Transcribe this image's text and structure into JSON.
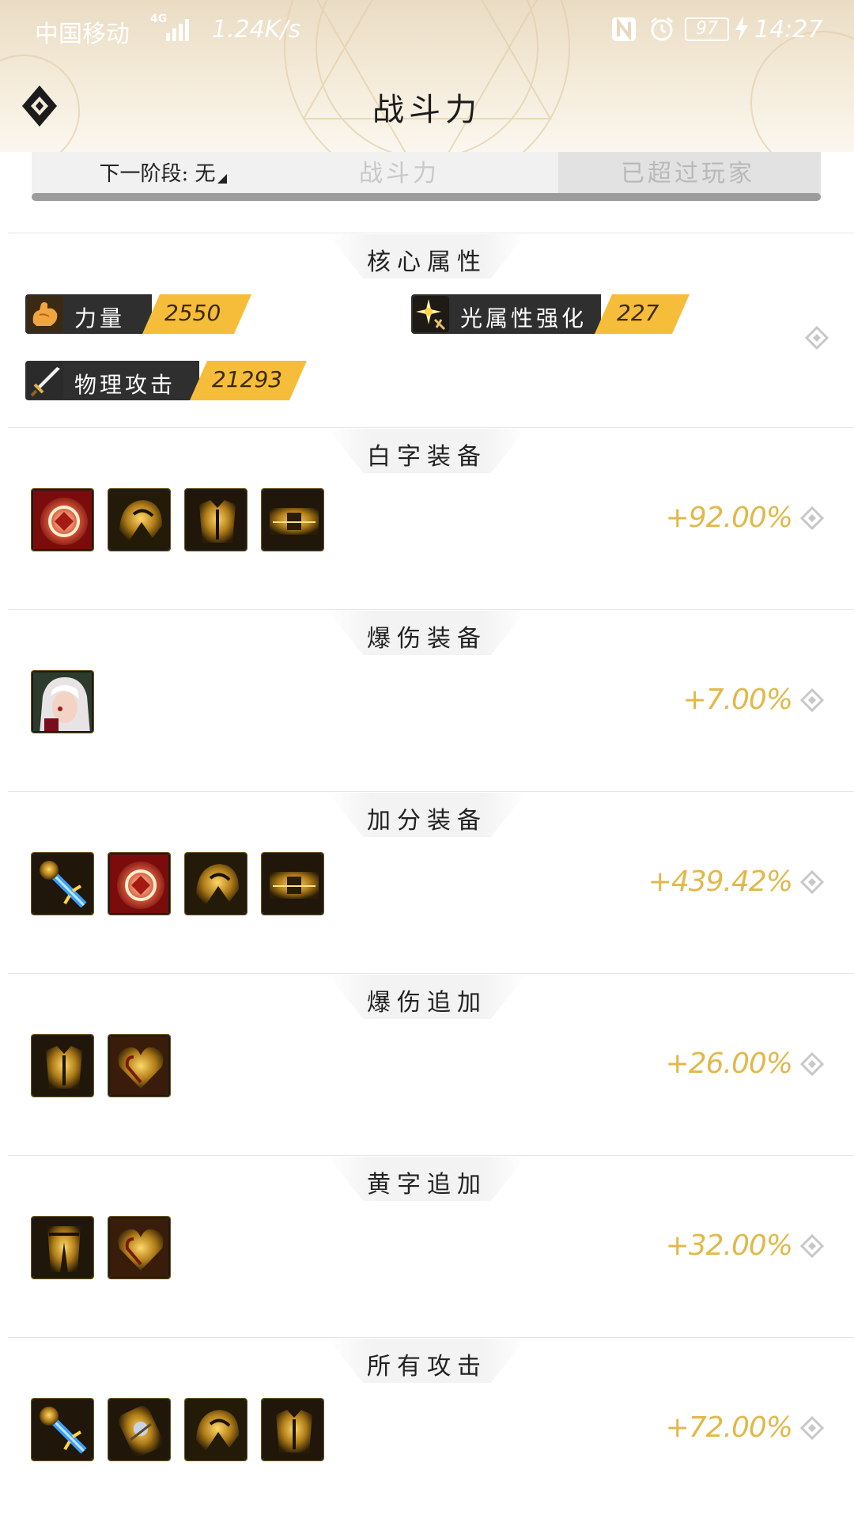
{
  "status_bar": {
    "carrier": "中国移动",
    "network": "4G",
    "speed": "1.24K/s",
    "battery": "97",
    "time": "14:27"
  },
  "header": {
    "title": "战斗力"
  },
  "tabs": {
    "next_stage": "下一阶段: 无",
    "power": "战斗力",
    "exceeded": "已超过玩家"
  },
  "core": {
    "title": "核心属性",
    "stats": [
      {
        "label": "力量",
        "value": "2550",
        "icon": "fist-icon"
      },
      {
        "label": "光属性强化",
        "value": "227",
        "icon": "light-star-icon"
      },
      {
        "label": "物理攻击",
        "value": "21293",
        "icon": "sword-icon"
      }
    ]
  },
  "sections": [
    {
      "title": "白字装备",
      "value": "+92.00%",
      "items": [
        "red-medallion",
        "golden-helmet",
        "golden-armor",
        "golden-belt"
      ]
    },
    {
      "title": "爆伤装备",
      "value": "+7.00%",
      "items": [
        "white-haired-portrait"
      ]
    },
    {
      "title": "加分装备",
      "value": "+439.42%",
      "items": [
        "blue-staff",
        "red-medallion",
        "golden-helmet",
        "golden-belt"
      ]
    },
    {
      "title": "爆伤追加",
      "value": "+26.00%",
      "items": [
        "golden-armor",
        "golden-heart"
      ]
    },
    {
      "title": "黄字追加",
      "value": "+32.00%",
      "items": [
        "golden-pants",
        "golden-heart"
      ]
    },
    {
      "title": "所有攻击",
      "value": "+72.00%",
      "items": [
        "blue-staff",
        "golden-bracer",
        "golden-helmet",
        "golden-armor"
      ]
    }
  ],
  "colors": {
    "accent_gold": "#f6bd3a",
    "percent_text": "#e1b84a",
    "badge_dark": "#2f2f30"
  }
}
